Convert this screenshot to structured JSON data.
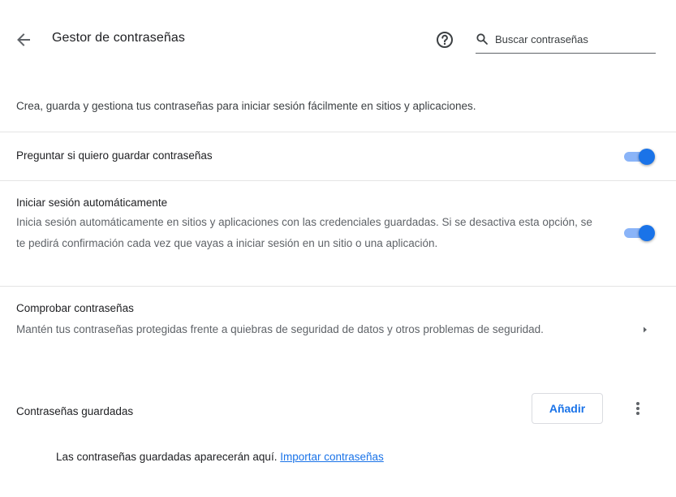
{
  "header": {
    "title": "Gestor de contraseñas",
    "back_icon": "arrow-back-icon",
    "help_icon": "help-circle-icon",
    "search": {
      "icon": "search-icon",
      "placeholder": "Buscar contraseñas",
      "value": ""
    }
  },
  "intro": {
    "text": "Crea, guarda y gestiona tus contraseñas para iniciar sesión fácilmente en sitios y aplicaciones."
  },
  "offer_to_save": {
    "label": "Preguntar si quiero guardar contraseñas",
    "enabled": true
  },
  "auto_signin": {
    "label": "Iniciar sesión automáticamente",
    "description": "Inicia sesión automáticamente en sitios y aplicaciones con las credenciales guardadas. Si se desactiva esta opción, se te pedirá confirmación cada vez que vayas a iniciar sesión en un sitio o una aplicación.",
    "enabled": true
  },
  "check_passwords": {
    "label": "Comprobar contraseñas",
    "description": "Mantén tus contraseñas protegidas frente a quiebras de seguridad de datos y otros problemas de seguridad."
  },
  "saved_passwords": {
    "label": "Contraseñas guardadas",
    "add_button": "Añadir",
    "more_icon": "more-vert-icon",
    "empty_text": "Las contraseñas guardadas aparecerán aquí.",
    "import_link": "Importar contraseñas"
  },
  "colors": {
    "accent": "#1a73e8",
    "toggle_track": "#8ab4f8",
    "divider": "#e4e4e4"
  }
}
